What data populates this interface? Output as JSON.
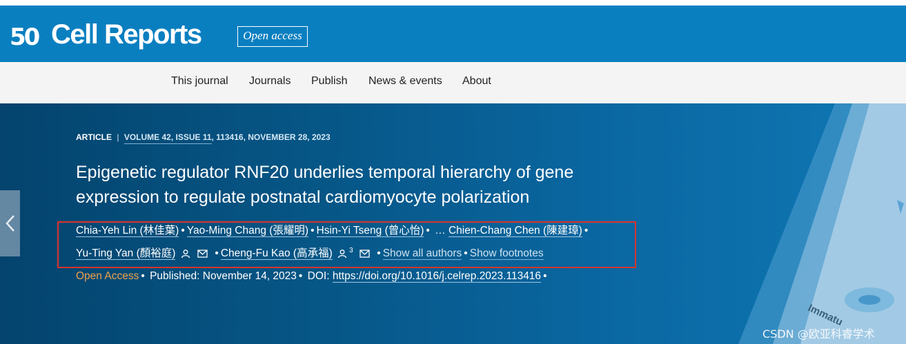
{
  "header": {
    "logo_mark": "50",
    "logo_text": "Cell Reports",
    "badge": "Open access"
  },
  "nav": {
    "items": [
      "This journal",
      "Journals",
      "Publish",
      "News & events",
      "About"
    ]
  },
  "article": {
    "type": "ARTICLE",
    "separator": "|",
    "volume": "VOLUME 42, ISSUE 11",
    "details": ", 113416, NOVEMBER 28, 2023",
    "title": "Epigenetic regulator RNF20 underlies temporal hierarchy of gene expression to regulate postnatal cardiomyocyte polarization",
    "authors": {
      "a1": "Chia-Yeh Lin (林佳葉)",
      "a2": "Yao-Ming Chang (張耀明)",
      "a3": "Hsin-Yi Tseng (曾心怡)",
      "ellipsis": "…",
      "a4": "Chien-Chang Chen (陳建璋)",
      "a5": "Yu-Ting Yan (顏裕庭)",
      "a6": "Cheng-Fu Kao (高承福)",
      "a6_sup": "3",
      "show_all": "Show all authors",
      "show_footnotes": "Show footnotes"
    },
    "pub": {
      "open_access": "Open Access",
      "published": "Published: November 14, 2023",
      "doi_label": "DOI:",
      "doi": "https://doi.org/10.1016/j.celrep.2023.113416"
    }
  },
  "decoration": {
    "figure_text": "Immatu"
  },
  "watermark": "CSDN @欧亚科睿学术",
  "colors": {
    "header_blue": "#0a7fc0",
    "open_access_orange": "#f0a24a",
    "highlight_red": "#d9342b"
  },
  "icons": [
    "chevron-left-icon",
    "person-icon",
    "mail-icon"
  ]
}
